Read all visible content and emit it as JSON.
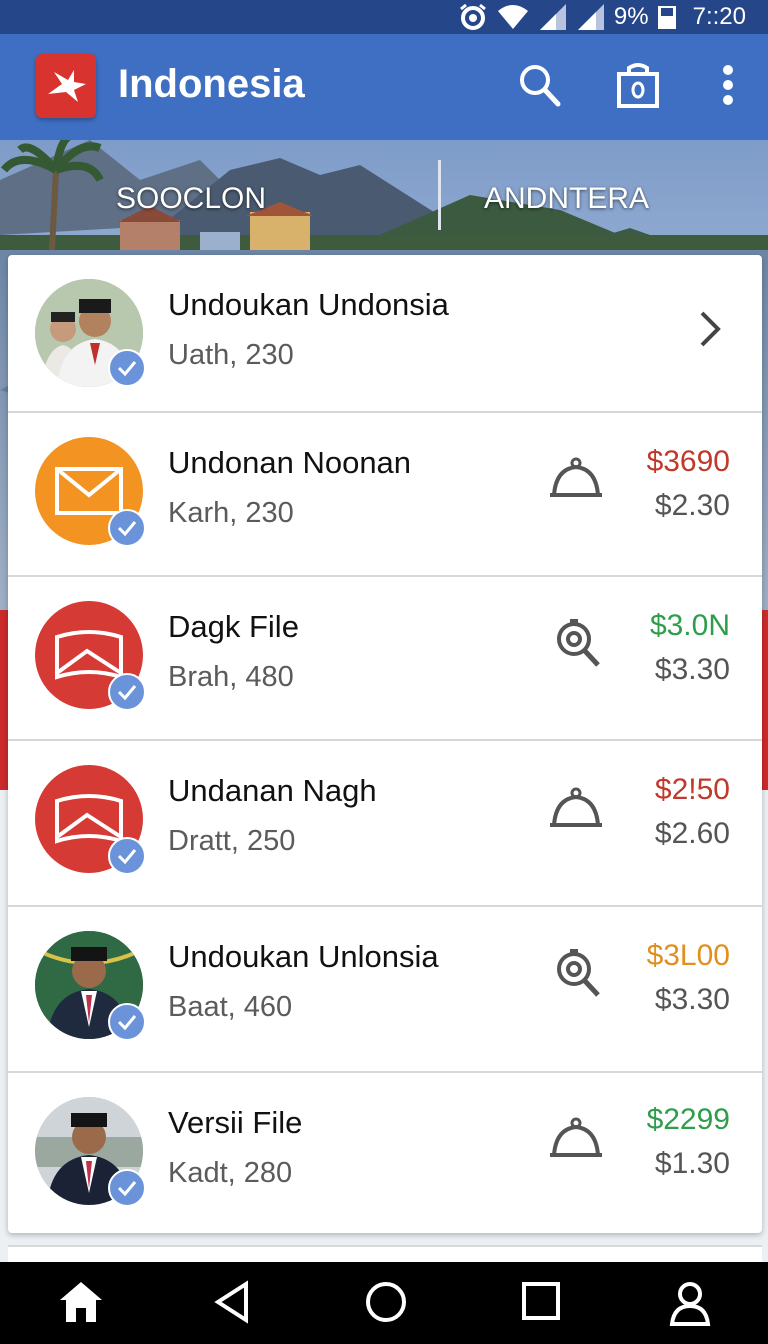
{
  "status_bar": {
    "battery": "9%",
    "time": "7::20"
  },
  "app_bar": {
    "title": "Indonesia",
    "icons": [
      "search-icon",
      "bag-icon",
      "more-vert-icon"
    ]
  },
  "hero": {
    "tabs": [
      "SOOCLON",
      "ANDNTERA"
    ]
  },
  "items": [
    {
      "title": "Undoukan Undonsia",
      "subtitle": "Uath, 230",
      "action_icon": "chevron-right-icon",
      "price_top": "",
      "price_bottom": ""
    },
    {
      "title": "Undonan Noonan",
      "subtitle": "Karh, 230",
      "action_icon": "bell-icon",
      "price_top": "$3690",
      "price_top_color": "#c0392b",
      "price_bottom": "$2.30"
    },
    {
      "title": "Dagk File",
      "subtitle": "Brah, 480",
      "action_icon": "magnifier-icon",
      "price_top": "$3.0N",
      "price_top_color": "#2e9e4a",
      "price_bottom": "$3.30"
    },
    {
      "title": "Undanan Nagh",
      "subtitle": "Dratt, 250",
      "action_icon": "bell-icon",
      "price_top": "$2!50",
      "price_top_color": "#c0392b",
      "price_bottom": "$2.60"
    },
    {
      "title": "Undoukan Unlonsia",
      "subtitle": "Baat, 460",
      "action_icon": "magnifier-icon",
      "price_top": "$3L00",
      "price_top_color": "#e0901e",
      "price_bottom": "$3.30"
    },
    {
      "title": "Versii File",
      "subtitle": "Kadt, 280",
      "action_icon": "bell-icon",
      "price_top": "$2299",
      "price_top_color": "#2e9e4a",
      "price_bottom": "$1.30"
    }
  ],
  "nav_bar": {
    "icons": [
      "home-icon",
      "back-icon",
      "home-circle-icon",
      "recents-icon",
      "profile-icon"
    ]
  },
  "colors": {
    "status_bar": "#26468a",
    "app_bar": "#3f6fc2",
    "logo": "#d9332f",
    "check_badge": "#6a93da"
  }
}
